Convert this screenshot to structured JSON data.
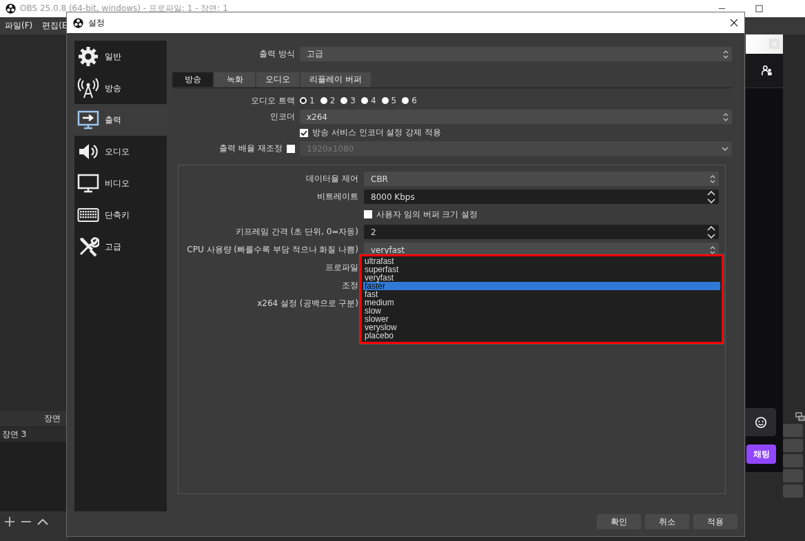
{
  "app_window": {
    "title": "OBS 25.0.8 (64-bit, windows) - 프로파일: 1 - 장면: 1",
    "menu": [
      "파일(F)",
      "편집(E"
    ]
  },
  "scenes_dock": {
    "title": "장면",
    "items": [
      {
        "label": "장면 3",
        "selected": false
      }
    ]
  },
  "chat_dock": {
    "send_button": "채팅"
  },
  "dialog": {
    "title": "설정",
    "sidebar": [
      {
        "label": "일반",
        "selected": false
      },
      {
        "label": "방송",
        "selected": false
      },
      {
        "label": "출력",
        "selected": true
      },
      {
        "label": "오디오",
        "selected": false
      },
      {
        "label": "비디오",
        "selected": false
      },
      {
        "label": "단축키",
        "selected": false
      },
      {
        "label": "고급",
        "selected": false
      }
    ],
    "output_mode": {
      "label": "출력 방식",
      "value": "고급"
    },
    "tabs": [
      {
        "label": "방송",
        "selected": true
      },
      {
        "label": "녹화",
        "selected": false
      },
      {
        "label": "오디오",
        "selected": false
      },
      {
        "label": "리플레이 버퍼",
        "selected": false
      }
    ],
    "audio_track": {
      "label": "오디오 트랙",
      "tracks": [
        {
          "label": "1",
          "selected": true
        },
        {
          "label": "2",
          "selected": false
        },
        {
          "label": "3",
          "selected": false
        },
        {
          "label": "4",
          "selected": false
        },
        {
          "label": "5",
          "selected": false
        },
        {
          "label": "6",
          "selected": false
        }
      ]
    },
    "encoder": {
      "label": "인코더",
      "value": "x264"
    },
    "enforce_service_settings": {
      "label": "방송 서비스 인코더 설정 강제 적용",
      "checked": true
    },
    "rescale_output": {
      "label": "출력 배율 재조정",
      "checked": false,
      "value": "1920x1080",
      "disabled": true
    },
    "encoder_settings": [
      {
        "kind": "select",
        "label": "데이터율 제어",
        "value": "CBR"
      },
      {
        "kind": "spin",
        "label": "비트레이트",
        "value": "8000 Kbps"
      },
      {
        "kind": "checkbox",
        "label": "사용자 임의 버퍼 크기 설정",
        "checked": false
      },
      {
        "kind": "spin",
        "label": "키프레임 간격 (초 단위, 0=자동)",
        "value": "2"
      },
      {
        "kind": "select",
        "label": "CPU 사용량 (빠를수록 부담 적으나 화질 나쁨)",
        "value": "veryfast"
      },
      {
        "kind": "label",
        "label": "프로파일"
      },
      {
        "kind": "label",
        "label": "조정"
      },
      {
        "kind": "label",
        "label": "x264 설정 (공백으로 구분)"
      }
    ],
    "preset_dropdown": {
      "options": [
        {
          "label": "ultrafast",
          "selected": false
        },
        {
          "label": "superfast",
          "selected": false
        },
        {
          "label": "veryfast",
          "selected": false
        },
        {
          "label": "faster",
          "selected": true
        },
        {
          "label": "fast",
          "selected": false
        },
        {
          "label": "medium",
          "selected": false
        },
        {
          "label": "slow",
          "selected": false
        },
        {
          "label": "slower",
          "selected": false
        },
        {
          "label": "veryslow",
          "selected": false
        },
        {
          "label": "placebo",
          "selected": false
        }
      ]
    },
    "buttons": [
      "확인",
      "취소",
      "적용"
    ]
  }
}
